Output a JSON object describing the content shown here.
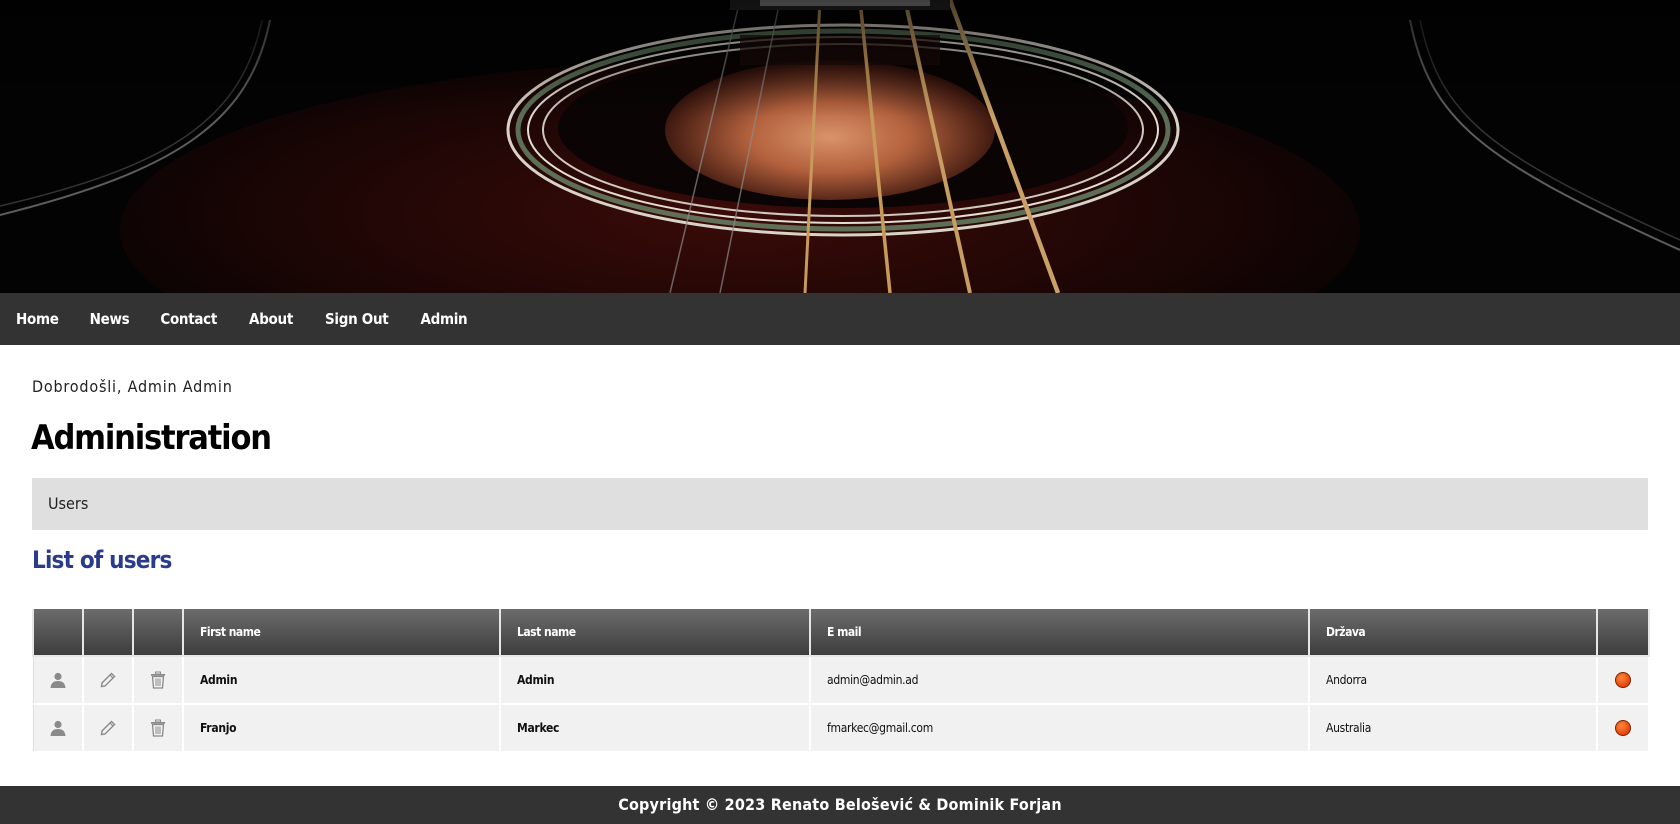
{
  "banner": {
    "image_name": "guitar-soundhole-image"
  },
  "nav": {
    "items": [
      {
        "label": "Home"
      },
      {
        "label": "News"
      },
      {
        "label": "Contact"
      },
      {
        "label": "About"
      },
      {
        "label": "Sign Out"
      },
      {
        "label": "Admin"
      }
    ]
  },
  "main": {
    "welcome": "Dobrodošli, Admin Admin",
    "title": "Administration",
    "section_tab": "Users",
    "list_title": "List of users"
  },
  "table": {
    "columns": [
      "",
      "",
      "",
      "First name",
      "Last name",
      "E mail",
      "Država",
      ""
    ],
    "row_icons": [
      "user-icon",
      "pencil-icon",
      "trash-icon"
    ],
    "rows": [
      {
        "first_name": "Admin",
        "last_name": "Admin",
        "email": "admin@admin.ad",
        "country": "Andorra",
        "status_color": "#e5420b"
      },
      {
        "first_name": "Franjo",
        "last_name": "Markec",
        "email": "fmarkec@gmail.com",
        "country": "Australia",
        "status_color": "#e5420b"
      }
    ]
  },
  "footer": {
    "text": "Copyright © 2023 Renato Belošević & Dominik Forjan"
  },
  "colors": {
    "nav_bg": "#333333",
    "footer_bg": "#333333",
    "accent_title": "#2b3b8c",
    "section_tab_bg": "#dfdfdf",
    "table_header_top": "#6c6c6c",
    "table_header_bottom": "#3d3d3d",
    "status": "#e5420b"
  }
}
